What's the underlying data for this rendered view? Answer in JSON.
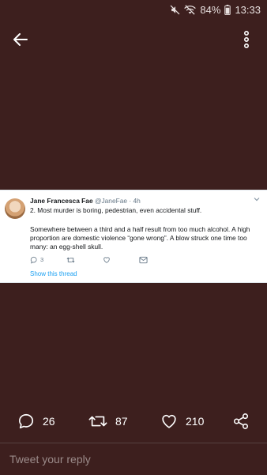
{
  "status_bar": {
    "battery": "84%",
    "time": "13:33"
  },
  "tweet": {
    "author_name": "Jane Francesca Fae",
    "handle": "@JaneFae",
    "separator": "·",
    "time": "4h",
    "line1": "2.   Most murder is boring, pedestrian, even accidental stuff.",
    "paragraph": [
      "Somewhere between a third and a half result from too much alcohol. A high",
      "proportion are domestic violence “gone wrong”. A blow struck one time too",
      "many: an egg-shell skull."
    ],
    "reply_count": "3",
    "show_thread": "Show this thread"
  },
  "actions": {
    "replies": "26",
    "retweets": "87",
    "likes": "210"
  },
  "reply_bar": {
    "placeholder": "Tweet your reply"
  },
  "colors": {
    "background": "#3d1f1e",
    "accent": "#1da1f2"
  }
}
